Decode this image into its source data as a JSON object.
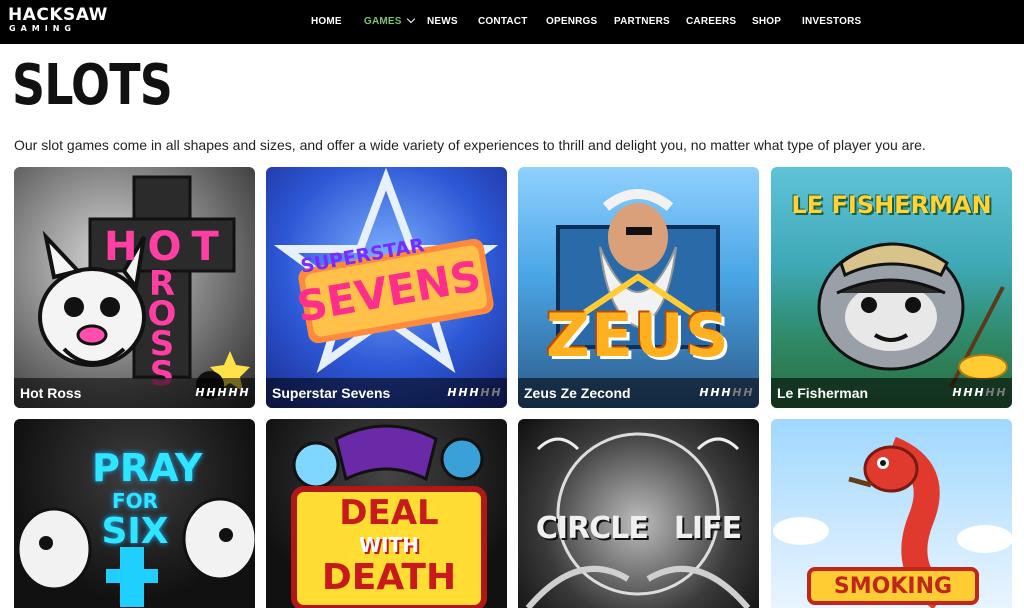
{
  "header": {
    "logo": {
      "main": "HACKSAW",
      "sub": "GAMING"
    },
    "nav": [
      {
        "label": "HOME",
        "active": false
      },
      {
        "label": "GAMES",
        "active": true,
        "dropdown": true
      },
      {
        "label": "NEWS",
        "active": false
      },
      {
        "label": "CONTACT",
        "active": false
      },
      {
        "label": "OPENRGS",
        "active": false
      },
      {
        "label": "PARTNERS",
        "active": false
      },
      {
        "label": "CAREERS",
        "active": false
      },
      {
        "label": "SHOP",
        "active": false
      },
      {
        "label": "INVESTORS",
        "active": false
      }
    ]
  },
  "page": {
    "title": "SLOTS",
    "description": "Our slot games come in all shapes and sizes, and offer a wide variety of experiences to thrill and delight you, no matter what type of player you are."
  },
  "games": [
    {
      "name": "Hot Ross",
      "volatility": 5,
      "volatility_max": 5,
      "art_text": [
        "HOT",
        "ROSS"
      ]
    },
    {
      "name": "Superstar Sevens",
      "volatility": 3,
      "volatility_max": 5,
      "art_text": [
        "SUPERSTAR",
        "SEVENS"
      ]
    },
    {
      "name": "Zeus Ze Zecond",
      "volatility": 3,
      "volatility_max": 5,
      "art_text": [
        "ZEUS"
      ]
    },
    {
      "name": "Le Fisherman",
      "volatility": 3,
      "volatility_max": 5,
      "art_text": [
        "LE FISHERMAN"
      ]
    },
    {
      "name": "",
      "art_text": [
        "PRAY",
        "FOR",
        "SIX"
      ]
    },
    {
      "name": "",
      "art_text": [
        "DEAL",
        "WITH",
        "DEATH"
      ]
    },
    {
      "name": "",
      "art_text": [
        "CIRCLE",
        "LIFE"
      ]
    },
    {
      "name": "",
      "art_text": [
        "SMOKING"
      ]
    }
  ],
  "colors": {
    "header_bg": "#000000",
    "nav_active": "#79c46b",
    "nav_text": "#ffffff",
    "volatility_on": "#ffffff",
    "volatility_off": "#7a7a7a"
  }
}
